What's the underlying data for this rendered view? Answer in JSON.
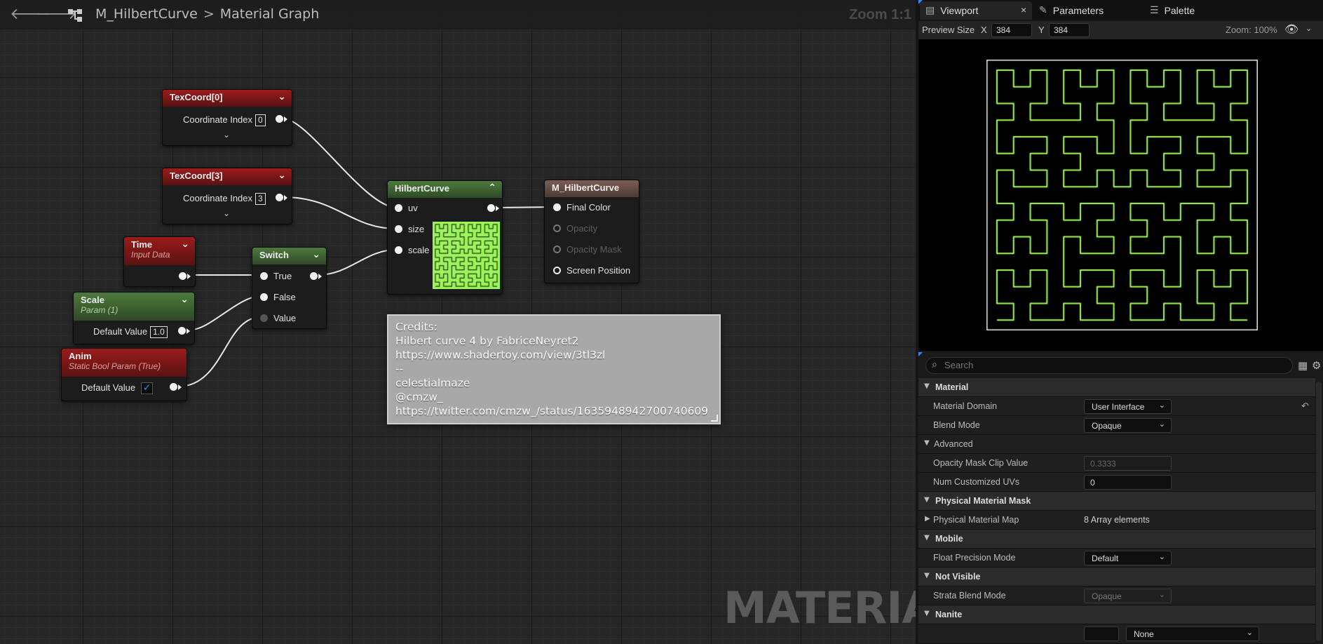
{
  "header": {
    "back_icon": "🡐",
    "forward_icon": "🡒",
    "asset_name": "M_HilbertCurve",
    "separator": ">",
    "graph_name": "Material Graph",
    "zoom": "Zoom 1:1"
  },
  "watermark": "MATERIAL",
  "nodes": {
    "texcoord0": {
      "title": "TexCoord[0]",
      "pin_label": "Coordinate Index",
      "value": "0"
    },
    "texcoord3": {
      "title": "TexCoord[3]",
      "pin_label": "Coordinate Index",
      "value": "3"
    },
    "time": {
      "title": "Time",
      "subtitle": "Input Data"
    },
    "scale": {
      "title": "Scale",
      "subtitle": "Param (1)",
      "pin_label": "Default Value",
      "value": "1.0"
    },
    "anim": {
      "title": "Anim",
      "subtitle": "Static Bool Param (True)",
      "pin_label": "Default Value",
      "checked": true
    },
    "switch": {
      "title": "Switch",
      "pins": [
        "True",
        "False",
        "Value"
      ]
    },
    "hilbert": {
      "title": "HilbertCurve",
      "pins": [
        "uv",
        "size",
        "scale"
      ]
    },
    "output": {
      "title": "M_HilbertCurve",
      "pins": [
        "Final Color",
        "Opacity",
        "Opacity Mask",
        "Screen Position"
      ]
    }
  },
  "comment": {
    "lines": [
      "Credits:",
      "Hilbert curve 4 by FabriceNeyret2",
      "https://www.shadertoy.com/view/3tl3zl",
      "--",
      "celestialmaze",
      "@cmzw_",
      "https://twitter.com/cmzw_/status/1635948942700740609"
    ]
  },
  "tabs": [
    {
      "label": "Viewport",
      "icon": "viewport-icon",
      "active": true,
      "close": "×"
    },
    {
      "label": "Parameters",
      "icon": "brush-icon"
    },
    {
      "label": "Palette",
      "icon": "list-icon"
    }
  ],
  "preview": {
    "label": "Preview Size",
    "x_label": "X",
    "x_value": "384",
    "y_label": "Y",
    "y_value": "384",
    "zoom": "Zoom: 100%",
    "curve_color": "#a8ff5a"
  },
  "details": {
    "search_placeholder": "Search",
    "rows": [
      {
        "type": "cat",
        "label": "Material"
      },
      {
        "type": "combo",
        "label": "Material Domain",
        "value": "User Interface"
      },
      {
        "type": "combo",
        "label": "Blend Mode",
        "value": "Opaque"
      },
      {
        "type": "subcat",
        "label": "Advanced"
      },
      {
        "type": "tbox-dis",
        "label": "Opacity Mask Clip Value",
        "value": "0.3333"
      },
      {
        "type": "tbox",
        "label": "Num Customized UVs",
        "value": "0"
      },
      {
        "type": "cat",
        "label": "Physical Material Mask"
      },
      {
        "type": "text",
        "label": "Physical Material Map",
        "value": "8 Array elements"
      },
      {
        "type": "cat",
        "label": "Mobile"
      },
      {
        "type": "combo",
        "label": "Float Precision Mode",
        "value": "Default"
      },
      {
        "type": "cat",
        "label": "Not Visible"
      },
      {
        "type": "combo-dis",
        "label": "Strata Blend Mode",
        "value": "Opaque"
      },
      {
        "type": "cat",
        "label": "Nanite"
      },
      {
        "type": "partial",
        "label": "",
        "value": "None"
      }
    ]
  },
  "colors": {
    "graph_bg": "#262626",
    "accent": "#2d8cf0",
    "node_red": "#9c1b1b",
    "node_green": "#4d7a3d"
  }
}
